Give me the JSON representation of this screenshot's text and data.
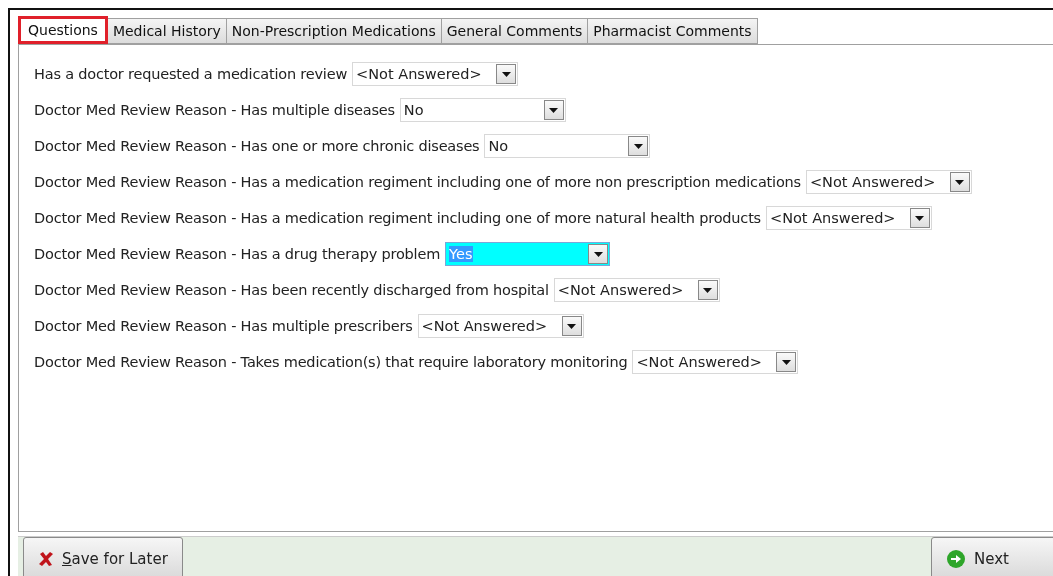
{
  "tabs": [
    {
      "label": "Questions",
      "selected": true
    },
    {
      "label": "Medical History",
      "selected": false
    },
    {
      "label": "Non-Prescription Medications",
      "selected": false
    },
    {
      "label": "General Comments",
      "selected": false
    },
    {
      "label": "Pharmacist Comments",
      "selected": false
    }
  ],
  "questions": [
    {
      "label": "Has a doctor requested a medication review",
      "value": "<Not Answered>",
      "focused": false
    },
    {
      "label": "Doctor Med Review Reason - Has multiple diseases",
      "value": "No",
      "focused": false
    },
    {
      "label": "Doctor Med Review Reason - Has one or more chronic diseases",
      "value": "No",
      "focused": false
    },
    {
      "label": "Doctor Med Review Reason - Has a medication regiment including one of more non prescription medications",
      "value": "<Not Answered>",
      "focused": false
    },
    {
      "label": "Doctor Med Review Reason - Has a medication regiment including one of more natural health products",
      "value": "<Not Answered>",
      "focused": false
    },
    {
      "label": "Doctor Med Review Reason - Has a drug therapy problem",
      "value": "Yes",
      "focused": true
    },
    {
      "label": "Doctor Med Review Reason - Has been recently discharged from hospital",
      "value": "<Not Answered>",
      "focused": false
    },
    {
      "label": "Doctor Med Review Reason - Has multiple prescribers",
      "value": "<Not Answered>",
      "focused": false
    },
    {
      "label": "Doctor Med Review Reason - Takes medication(s) that require laboratory monitoring",
      "value": "<Not Answered>",
      "focused": false
    }
  ],
  "footer": {
    "save_label": "Save for Later",
    "next_label": "Next"
  }
}
